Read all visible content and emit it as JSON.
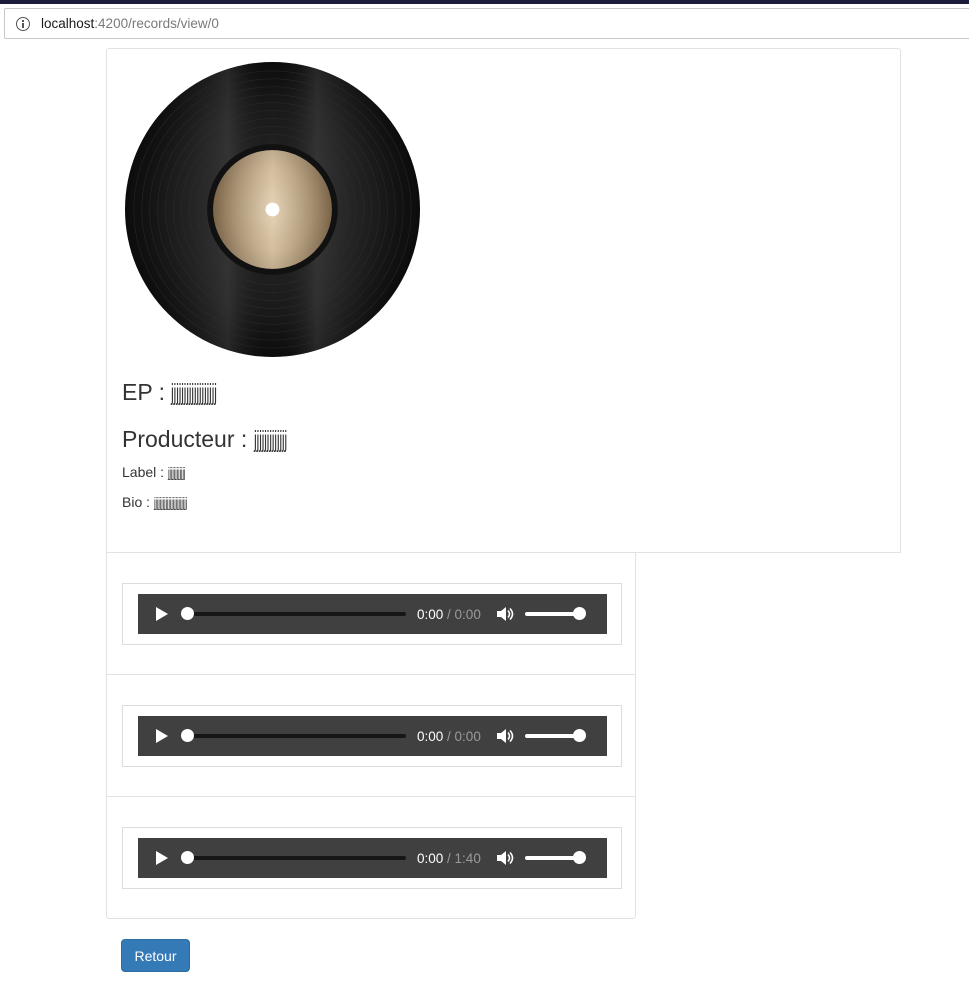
{
  "browser": {
    "url_host": "localhost",
    "url_rest": ":4200/records/view/0",
    "info_icon": "info-circle-icon"
  },
  "record": {
    "ep_prefix": "EP : ",
    "ep_value": "jjjjjjjjjjjjjjjjjj",
    "producer_prefix": "Producteur : ",
    "producer_value": "jjjjjjjjjjjjj",
    "label_prefix": "Label : ",
    "label_value": "jjjjjjjjjjjj",
    "bio_prefix": "Bio : ",
    "bio_value": "jjjjjjjjjjjjjjjjjjjjjjj",
    "image": "vinyl-record-image"
  },
  "tracks": [
    {
      "current": "0:00",
      "separator": " / ",
      "duration": "0:00",
      "progress": 0,
      "volume": 1.0
    },
    {
      "current": "0:00",
      "separator": " / ",
      "duration": "0:00",
      "progress": 0,
      "volume": 1.0
    },
    {
      "current": "0:00",
      "separator": " / ",
      "duration": "1:40",
      "progress": 0,
      "volume": 1.0
    }
  ],
  "actions": {
    "back_label": "Retour"
  },
  "colors": {
    "button_primary": "#337ab7",
    "player_bg": "#404040"
  }
}
